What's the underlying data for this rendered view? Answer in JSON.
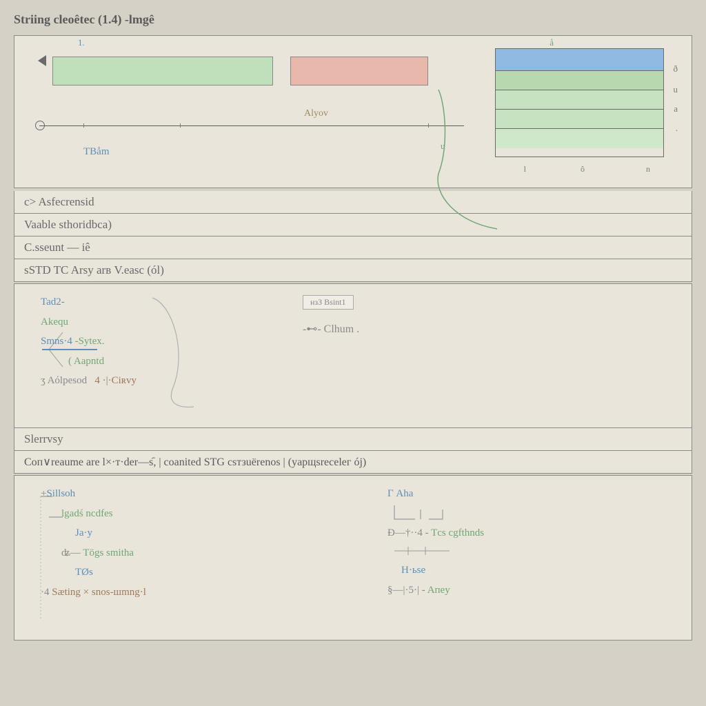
{
  "title": "Striing cleoêtec (1.4) -lmgê",
  "diagram": {
    "top_tick": "1.",
    "right_top_tick": "å",
    "arrow_hint": "N",
    "mid_label": "Alyov",
    "bottom_label_left": "TBåm",
    "stack_labels": [
      "ð",
      "u",
      "a",
      "."
    ],
    "stack_bottom_ticks": [
      "l",
      "ô",
      "n"
    ],
    "curve_end_label": "u"
  },
  "sections": {
    "s1": "c> Asfecrensid",
    "s2": "Vaable sthoridbca)",
    "s3": "C.sseunt — iê",
    "s4": "sSTD TC Arsy arв V.easc (ól)",
    "s5": "Slerrvsy",
    "s6": "Cоп∨reaume arе l×·т·der—s᷇, | coanited STG сsтзuёrеnos | (yарщsrеceleг ój)"
  },
  "mid_panel": {
    "items": [
      {
        "key": "ad2",
        "label": "Tad2-",
        "color": "blue"
      },
      {
        "key": "akqu",
        "label": "Akеqu",
        "color": "green"
      },
      {
        "key": "smns",
        "label": "Smns·4",
        "suffix": "-Sytеx.",
        "color": "blue"
      },
      {
        "key": "apnd",
        "label": "( Aapntd",
        "color": "green"
      },
      {
        "key": "apes",
        "label": "ʒ Aólpеsod",
        "suffix": "4 ·|·Ciʀvy",
        "color": "gray"
      }
    ],
    "right_box": "нзЗ Bsint1",
    "right_hint": "-⊷- Clhum .",
    "bracket_label": "}"
  },
  "bottom_panel": {
    "left": [
      {
        "label": "Sillsoh",
        "color": "blue",
        "prefix": "+"
      },
      {
        "label": "lgadś ncdfes",
        "color": "green",
        "indent": true
      },
      {
        "label": "Ja·y",
        "color": "blue",
        "indent": true
      },
      {
        "label": "Tögs smithа",
        "color": "green",
        "prefix": "ʥ—",
        "indent": true
      },
      {
        "label": "TØs",
        "color": "blue",
        "indent": true
      },
      {
        "label": "Sæting × snos-шmng·l",
        "color": "brown",
        "prefix": "·4"
      }
    ],
    "right": [
      {
        "label": "Г Aha",
        "color": "blue"
      },
      {
        "label": "",
        "color": "gray"
      },
      {
        "label": "Tсs cgfthnds",
        "color": "green",
        "prefix": "Ð—†··4 -"
      },
      {
        "label": "",
        "color": "gray"
      },
      {
        "label": "H·ьse",
        "color": "blue"
      },
      {
        "label": "Aпеy",
        "color": "green",
        "prefix": "§—|·5·| -"
      }
    ]
  }
}
